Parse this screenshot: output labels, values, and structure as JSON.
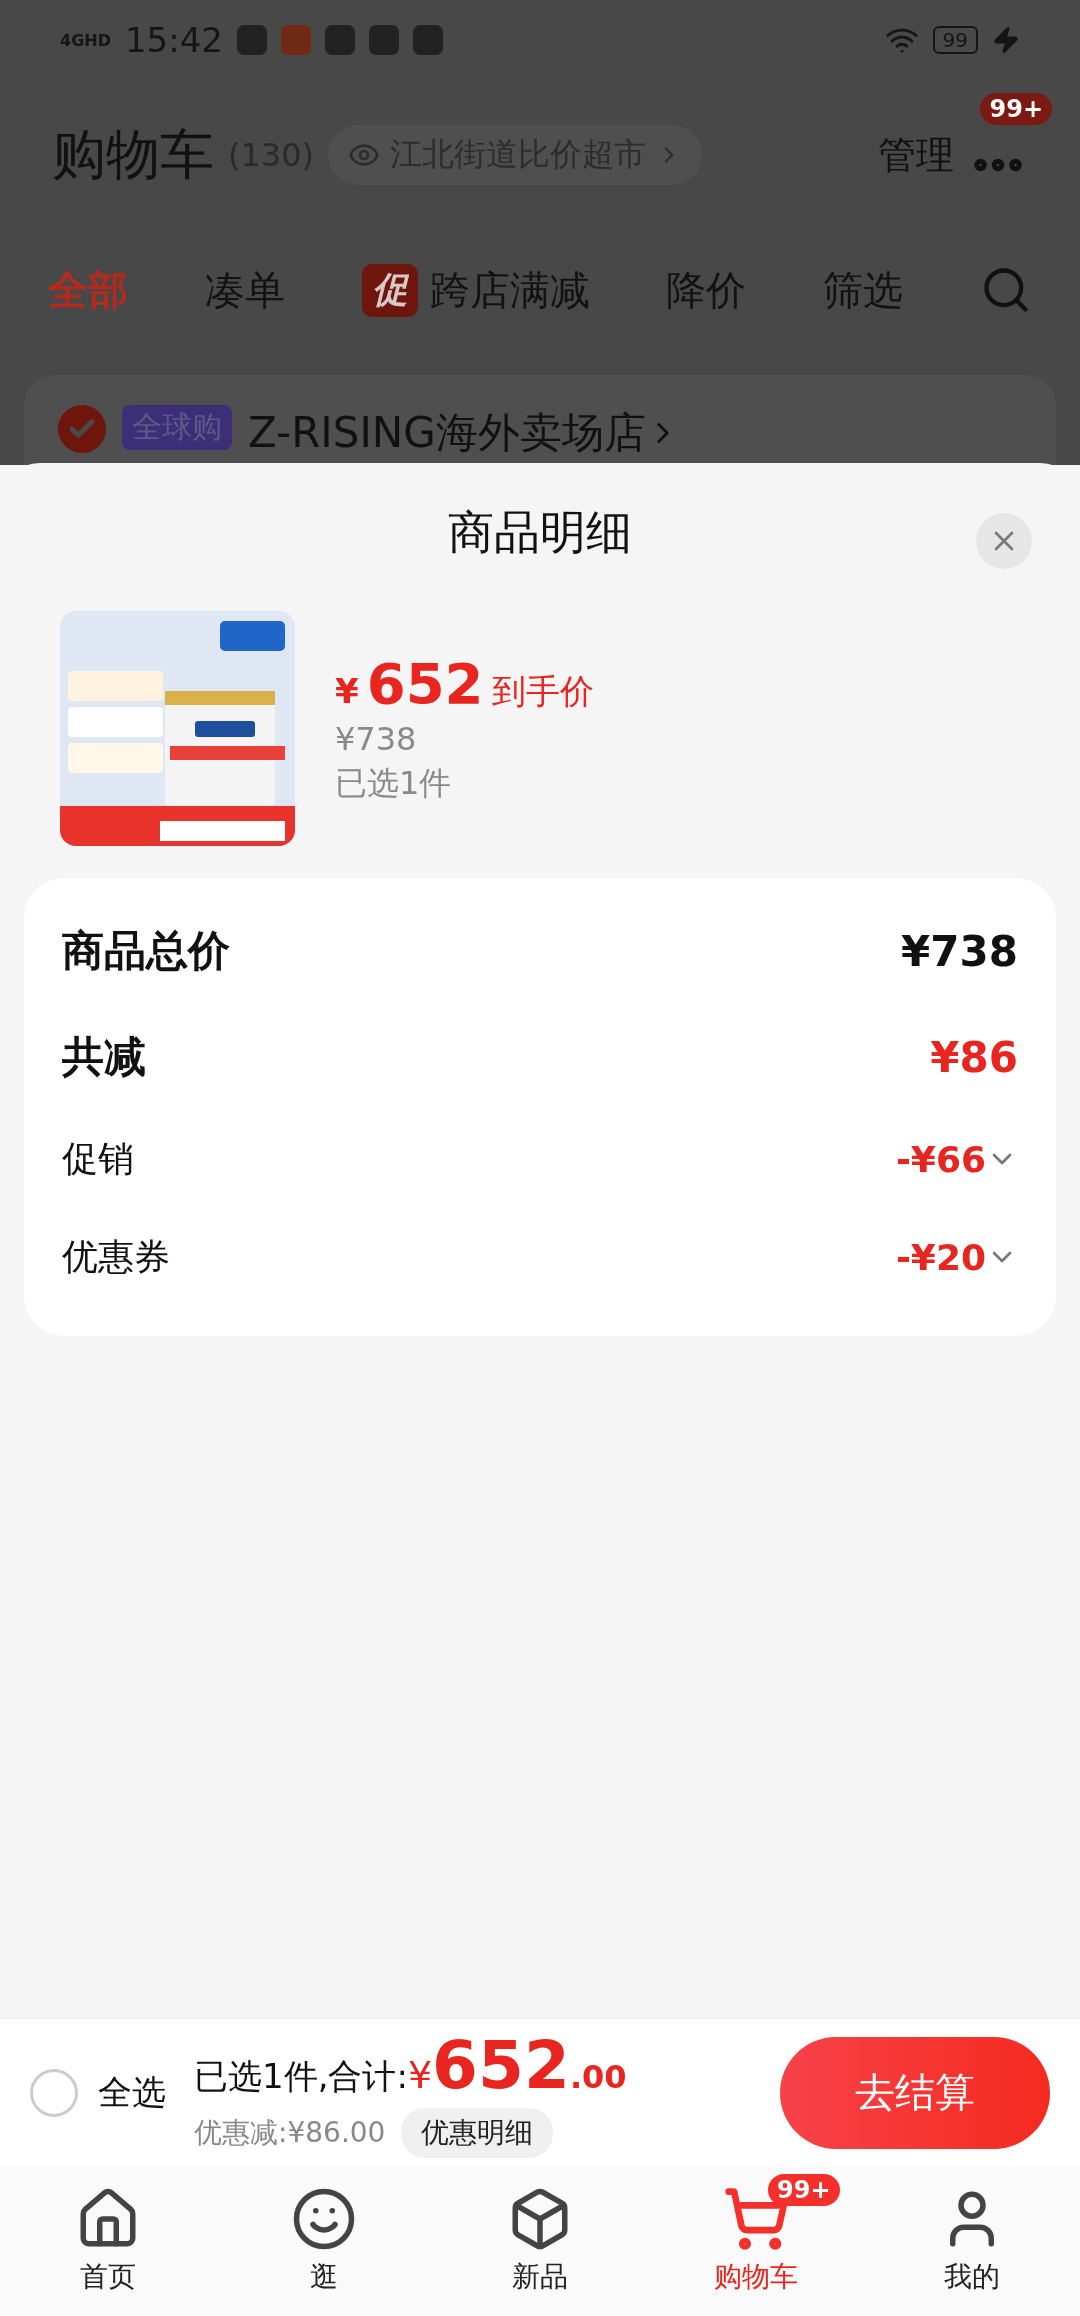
{
  "status_bar": {
    "network": "4GHD",
    "time": "15:42",
    "battery": "99"
  },
  "header": {
    "title": "购物车",
    "count": "(130)",
    "store_link": "江北街道比价超市",
    "manage": "管理",
    "badge": "99+"
  },
  "tabs": [
    {
      "label": "全部",
      "selected": true
    },
    {
      "label": "凑单",
      "selected": false
    },
    {
      "label": "跨店满减",
      "tag": "促",
      "selected": false
    },
    {
      "label": "降价",
      "selected": false
    },
    {
      "label": "筛选",
      "selected": false
    }
  ],
  "store": {
    "checked": true,
    "tag": "全球购",
    "name": "Z-RISING海外卖场店"
  },
  "sheet": {
    "title": "商品明细",
    "product": {
      "currency": "¥",
      "price": "652",
      "price_label": "到手价",
      "original_price": "¥738",
      "selected_count": "已选1件"
    },
    "summary": [
      {
        "kind": "total",
        "label": "商品总价",
        "value": "¥738"
      },
      {
        "kind": "discount_total",
        "label": "共减",
        "value": "¥86"
      },
      {
        "kind": "detail",
        "label": "促销",
        "value": "-¥66"
      },
      {
        "kind": "detail",
        "label": "优惠券",
        "value": "-¥20"
      }
    ]
  },
  "checkout": {
    "select_all": {
      "label": "全选",
      "checked": false
    },
    "summary_prefix": "已选1件,合计:",
    "currency": "¥",
    "amount": "652",
    "decimals": ".00",
    "saving": "优惠减:¥86.00",
    "detail_button": "优惠明细",
    "submit": "去结算"
  },
  "nav": [
    {
      "kind": "home",
      "label": "首页",
      "selected": false
    },
    {
      "kind": "browse",
      "label": "逛",
      "selected": false
    },
    {
      "kind": "new",
      "label": "新品",
      "selected": false
    },
    {
      "kind": "cart",
      "label": "购物车",
      "selected": true,
      "badge": "99+"
    },
    {
      "kind": "me",
      "label": "我的",
      "selected": false
    }
  ]
}
